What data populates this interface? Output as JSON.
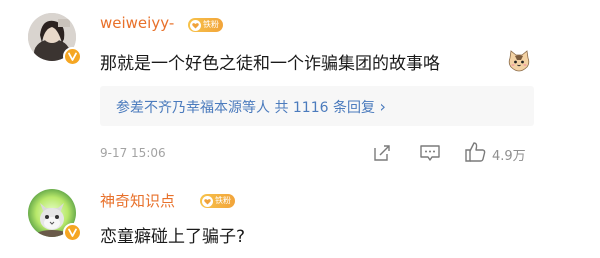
{
  "comments": [
    {
      "username": "weiweiyy-",
      "fan_level": "铁粉",
      "text": "那就是一个好色之徒和一个诈骗集团的故事咯",
      "emoji": "cat-face-emoji",
      "replies": {
        "users": "参差不齐乃幸福本源等人",
        "summary": "共 1116 条回复",
        "caret": "›"
      },
      "timestamp": "9-17 15:06",
      "likes": "4.9万"
    },
    {
      "username": "神奇知识点",
      "fan_level": "铁粉",
      "text": "恋童癖碰上了骗子?"
    }
  ],
  "colors": {
    "username": "#e8712b",
    "link": "#4b7bbd",
    "badge": "#f5a623",
    "meta": "#a3a3a3"
  }
}
